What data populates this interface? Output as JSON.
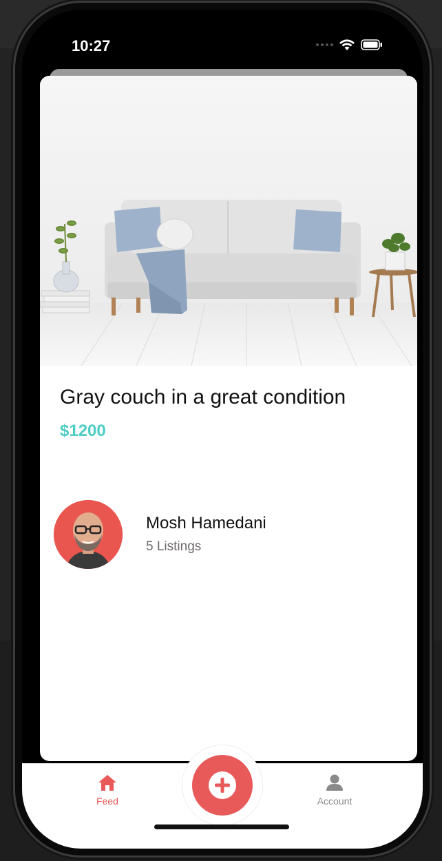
{
  "status_bar": {
    "time": "10:27"
  },
  "listing": {
    "title": "Gray couch in a great condition",
    "price": "$1200"
  },
  "seller": {
    "name": "Mosh Hamedani",
    "listings": "5 Listings"
  },
  "tabs": [
    {
      "label": "Feed",
      "icon": "home-icon",
      "active": true
    },
    {
      "label": "Account",
      "icon": "user-icon",
      "active": false
    }
  ],
  "colors": {
    "primary": "#e85a5a",
    "secondary": "#4ecdc4",
    "muted": "#6e6969"
  }
}
